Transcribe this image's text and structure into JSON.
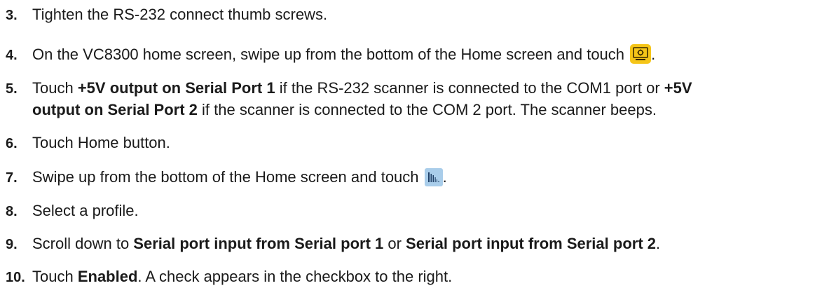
{
  "steps": [
    {
      "number": "3.",
      "parts": [
        {
          "text": "Tighten the RS-232 connect thumb screws.",
          "bold": false
        }
      ]
    },
    {
      "number": "4.",
      "parts": [
        {
          "text": "On the VC8300 home screen, swipe up from the bottom of the Home screen and touch ",
          "bold": false
        },
        {
          "icon": "settings-icon"
        },
        {
          "text": ".",
          "bold": false
        }
      ]
    },
    {
      "number": "5.",
      "line1": [
        {
          "text": "Touch ",
          "bold": false
        },
        {
          "text": "+5V output on Serial Port 1",
          "bold": true
        },
        {
          "text": " if the RS-232 scanner is connected to the COM1 port or ",
          "bold": false
        },
        {
          "text": "+5V",
          "bold": true
        }
      ],
      "line2": [
        {
          "text": "output on Serial Port 2",
          "bold": true
        },
        {
          "text": " if the scanner is connected to the COM 2 port. The scanner beeps.",
          "bold": false
        }
      ]
    },
    {
      "number": "6.",
      "parts": [
        {
          "text": "Touch Home button.",
          "bold": false
        }
      ]
    },
    {
      "number": "7.",
      "parts": [
        {
          "text": "Swipe up from the bottom of the Home screen and touch ",
          "bold": false
        },
        {
          "icon": "datawedge-icon"
        },
        {
          "text": ".",
          "bold": false
        }
      ]
    },
    {
      "number": "8.",
      "parts": [
        {
          "text": "Select a profile.",
          "bold": false
        }
      ]
    },
    {
      "number": "9.",
      "parts": [
        {
          "text": "Scroll down to ",
          "bold": false
        },
        {
          "text": "Serial port input from Serial port 1",
          "bold": true
        },
        {
          "text": " or ",
          "bold": false
        },
        {
          "text": "Serial port input from Serial port 2",
          "bold": true
        },
        {
          "text": ".",
          "bold": false
        }
      ]
    },
    {
      "number": "10.",
      "parts": [
        {
          "text": "Touch ",
          "bold": false
        },
        {
          "text": "Enabled",
          "bold": true
        },
        {
          "text": ". A check appears in the checkbox to the right.",
          "bold": false
        }
      ]
    }
  ],
  "colors": {
    "text": "#1a1a1a",
    "settings_icon_bg": "#f5c518",
    "scan_icon_bg": "#a9cdea"
  }
}
